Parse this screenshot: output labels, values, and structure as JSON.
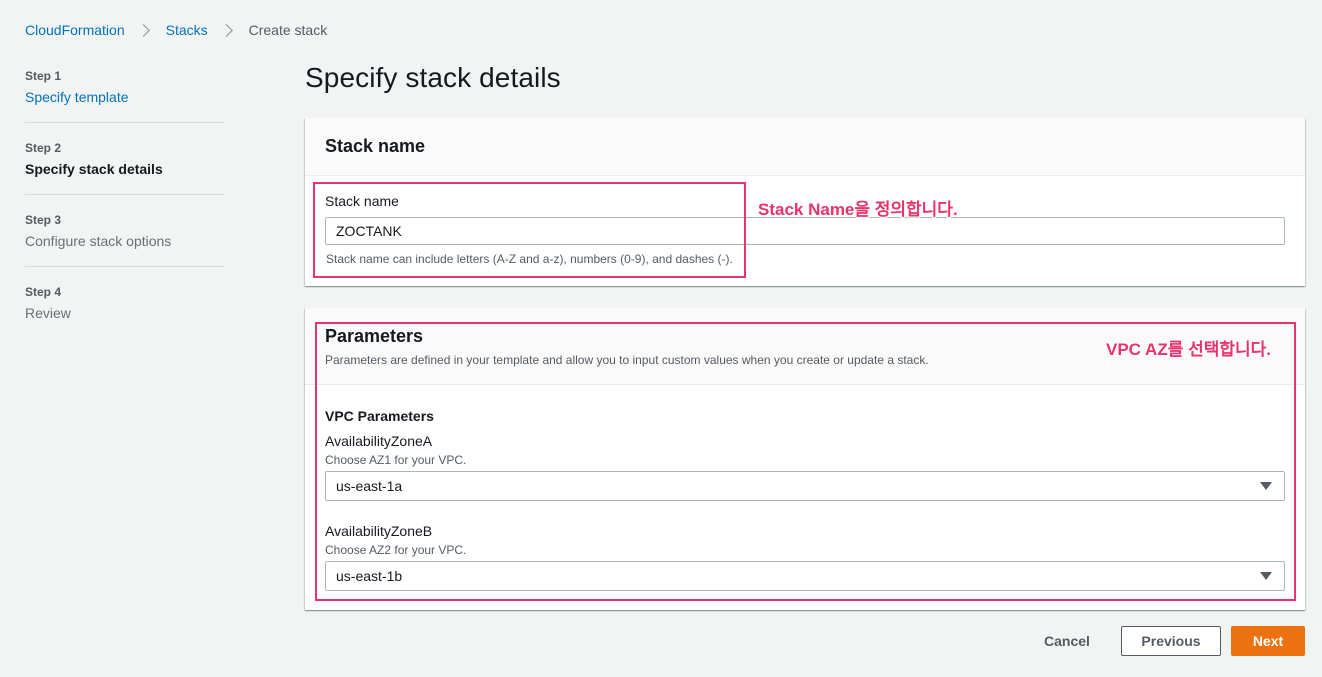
{
  "breadcrumb": {
    "items": [
      "CloudFormation",
      "Stacks"
    ],
    "current": "Create stack"
  },
  "steps": [
    {
      "num": "Step 1",
      "label": "Specify template"
    },
    {
      "num": "Step 2",
      "label": "Specify stack details"
    },
    {
      "num": "Step 3",
      "label": "Configure stack options"
    },
    {
      "num": "Step 4",
      "label": "Review"
    }
  ],
  "page_title": "Specify stack details",
  "stack_panel": {
    "title": "Stack name",
    "field_label": "Stack name",
    "value": "ZOCTANK",
    "hint": "Stack name can include letters (A-Z and a-z), numbers (0-9), and dashes (-)."
  },
  "params_panel": {
    "title": "Parameters",
    "description": "Parameters are defined in your template and allow you to input custom values when you create or update a stack.",
    "group_title": "VPC Parameters",
    "fields": [
      {
        "label": "AvailabilityZoneA",
        "hint": "Choose AZ1 for your VPC.",
        "value": "us-east-1a"
      },
      {
        "label": "AvailabilityZoneB",
        "hint": "Choose AZ2 for your VPC.",
        "value": "us-east-1b"
      }
    ]
  },
  "annotations": {
    "stack_name_note": "Stack Name을 정의합니다.",
    "vpc_az_note": "VPC AZ를 선택합니다."
  },
  "footer": {
    "cancel": "Cancel",
    "previous": "Previous",
    "next": "Next"
  },
  "colors": {
    "link": "#0073bb",
    "primary_button": "#ec7211",
    "annotation": "#e8336b",
    "background": "#f2f3f3"
  }
}
